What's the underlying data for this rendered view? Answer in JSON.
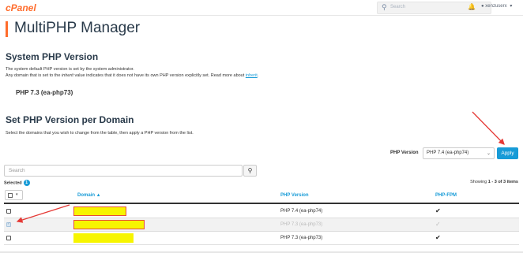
{
  "header": {
    "logo_text": "cPanel",
    "search_placeholder": "Search",
    "username": "xenzuserx",
    "user_chevron": "▾"
  },
  "page": {
    "title": "MultiPHP Manager"
  },
  "system_php": {
    "heading": "System PHP Version",
    "desc_line1": "The system default PHP version is set by the system administrator.",
    "desc_line2_pre": "Any domain that is set to the ",
    "desc_line2_em": "inherit",
    "desc_line2_mid": " value indicates that it does not have its own PHP version explicitly set. Read more about ",
    "desc_line2_link": "inherit",
    "desc_line2_post": ".",
    "current_version": "PHP 7.3 (ea-php73)"
  },
  "per_domain": {
    "heading": "Set PHP Version per Domain",
    "desc": "Select the domains that you wish to change from the table, then apply a PHP version from the list.",
    "php_version_label": "PHP Version",
    "selected_version": "PHP 7.4 (ea-php74)",
    "apply_label": "Apply"
  },
  "table": {
    "search_placeholder": "Search",
    "selected_label": "Selected",
    "selected_count": "1",
    "showing_pre": "Showing ",
    "showing_range": "1 - 3 of 3 items",
    "columns": {
      "domain": "Domain ▲",
      "php_version": "PHP Version",
      "php_fpm": "PHP-FPM"
    },
    "rows": [
      {
        "checked": false,
        "php_version": "PHP 7.4 (ea-php74)",
        "fpm": "✔"
      },
      {
        "checked": true,
        "php_version": "PHP 7.3 (ea-php73)",
        "fpm": "✓"
      },
      {
        "checked": false,
        "php_version": "PHP 7.3 (ea-php73)",
        "fpm": "✔"
      }
    ]
  },
  "icons": {
    "search": "search-icon",
    "bell": "bell-icon",
    "user": "user-icon",
    "checkmark": "checkmark-icon",
    "sort_asc": "sort-asc-icon"
  },
  "colors": {
    "brand": "#ff6c2c",
    "accent": "#179bd7",
    "redaction_fill": "#f7f500",
    "annotation_arrow": "#e53935"
  }
}
